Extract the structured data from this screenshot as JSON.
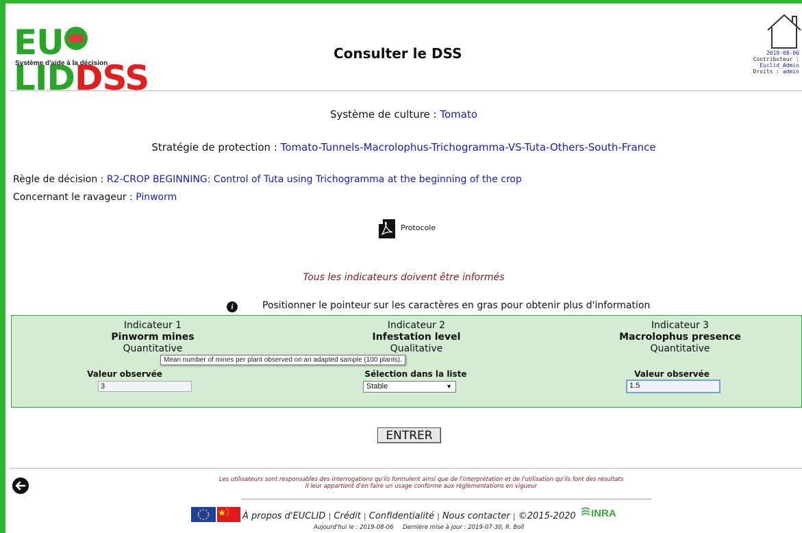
{
  "header": {
    "logo_word_a": "EU",
    "logo_word_b": "LID",
    "logo_word_c": "DSS",
    "logo_subtitle": "Système d'aide à la décision",
    "title": "Consulter le DSS",
    "date": "2019-08-06",
    "contributor_label": "Contributeur :",
    "contributor_name": "Euclid_Admin",
    "rights_label": "Droits :",
    "rights_value": "admin"
  },
  "info": {
    "system_label": "Système de culture :",
    "system_value": "Tomato",
    "strategy_label": "Stratégie de protection :",
    "strategy_value": "Tomato-Tunnels-Macrolophus-Trichogramma-VS-Tuta-Others-South-France",
    "rule_label": "Règle de décision :",
    "rule_value": "R2-CROP BEGINNING: Control of Tuta using Trichogramma at the beginning of the crop",
    "pest_label": "Concernant le ravageur :",
    "pest_value": "Pinworm",
    "protocol_label": "Protocole"
  },
  "warning": "Tous les indicateurs doivent être informés",
  "hint": "Positionner le pointeur sur les caractères en gras pour obtenir plus d'information",
  "indicators": [
    {
      "number": "Indicateur 1",
      "name": "Pinworm mines",
      "type": "Quantitative",
      "field_label": "Valeur observée",
      "value": "3"
    },
    {
      "number": "Indicateur 2",
      "name": "Infestation level",
      "type": "Qualitative",
      "field_label": "Sélection dans la liste",
      "value": "Stable"
    },
    {
      "number": "Indicateur 3",
      "name": "Macrolophus presence",
      "type": "Quantitative",
      "field_label": "Valeur observée",
      "value": "1.5"
    }
  ],
  "tooltip": "Mean number of mines per plant observed on an adapted sample (100 plants).",
  "submit_label": "ENTRER",
  "footer": {
    "disclaimer_1": "Les utilisateurs sont responsables des interrogations qu'ils formulent ainsi que de l'interprétation et de l'utilisation qu'ils font des résultats",
    "disclaimer_2": "Il leur appartient d'en faire un usage conforme aux réglementations en vigueur",
    "link_about": "À propos d'EUCLID",
    "link_credit": "Crédit",
    "link_privacy": "Confidentialité",
    "link_contact": "Nous contacter",
    "copyright": "©2015-2020",
    "today": "Aujourd'hui le : 2019-08-06",
    "last_update": "Dernière mise à jour : 2019-07-30, R. Boll",
    "inra_label": "INRA"
  },
  "colors": {
    "frame": "#2fb52f",
    "link": "#1a1acc",
    "warning": "#8b1a1a",
    "panel": "#d3ecd3"
  },
  "icons": [
    "home-icon",
    "pdf-icon",
    "info-icon",
    "back-arrow-icon",
    "eu-flag-icon",
    "china-flag-icon",
    "inra-logo"
  ]
}
